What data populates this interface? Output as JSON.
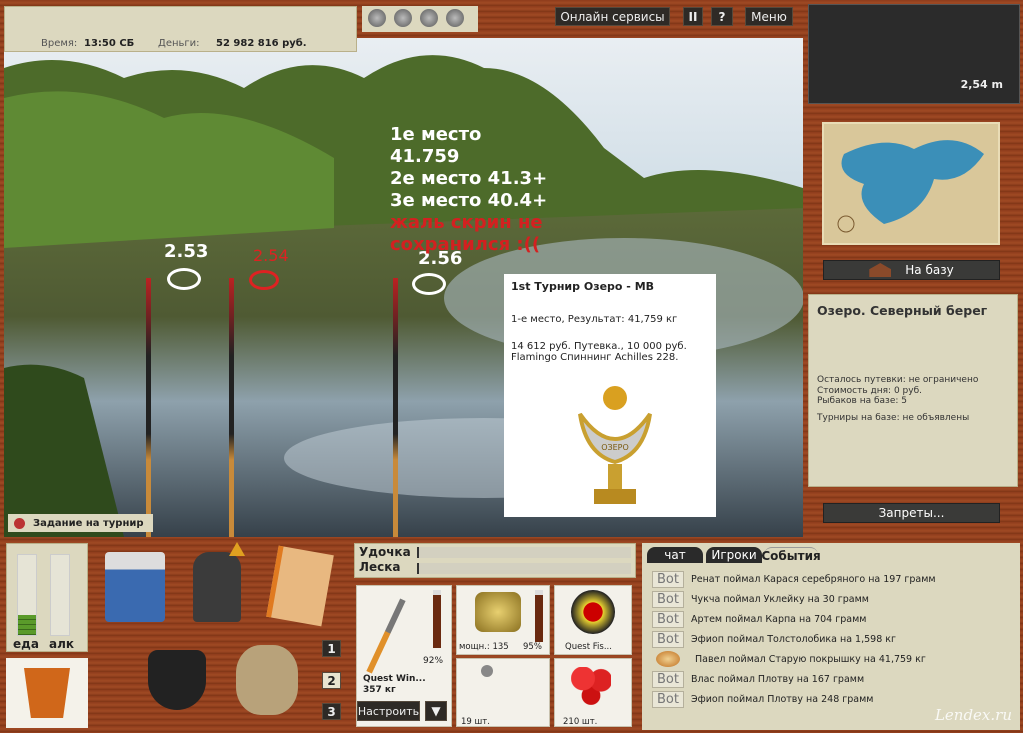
{
  "status": {
    "time_label": "Время:",
    "time": "13:50 СБ",
    "money_label": "Деньги:",
    "money": "52 982 816 руб."
  },
  "top_buttons": {
    "online": "Онлайн сервисы",
    "pause": "II",
    "help": "?",
    "menu": "Меню"
  },
  "depth": "2,54 m",
  "base_button": "На базу",
  "location": {
    "title": "Озеро. Северный берег",
    "permits": "Осталось путевки: не ограничено",
    "day_cost": "Стоимость дня: 0 руб.",
    "fishers": "Рыбаков на базе: 5",
    "tournaments": "Турниры на базе: не объявлены"
  },
  "bans_button": "Запреты...",
  "overlay": {
    "line1": "1е место 41.759",
    "line2": "2е место 41.3+",
    "line3": "3е место 40.4+",
    "line4": "жаль скрин не сохранился :((",
    "float1": "2.53",
    "float2": "2.54",
    "float3": "2.56"
  },
  "tournament": {
    "title": "1st Турнир Озеро - МВ",
    "result": "1-е место, Результат: 41,759 кг",
    "prize1": "14 612 руб. Путевка., 10 000 руб.",
    "prize2": "Flamingo Спиннинг Achilles 228.",
    "trophy_text": "ОЗЕРО"
  },
  "task_button": "Задание на турнир",
  "gauges": {
    "food": "еда",
    "alc": "алк",
    "food_level": 0.25,
    "alc_level": 0
  },
  "slots": [
    "1",
    "2",
    "3"
  ],
  "tension": {
    "rod": "Удочка",
    "line": "Леска"
  },
  "gear": {
    "rod_name": "Quest Win...",
    "rod_weight": "357 кг",
    "rod_pct": "92%",
    "reel_power": "мощн.: 135",
    "reel_pct": "95%",
    "line_name": "Quest Fis...",
    "hooks": "19 шт.",
    "bait": "210 шт.",
    "setup": "Настроить",
    "dropdown": "▼"
  },
  "chat": {
    "tabs": [
      "чат",
      "Игроки",
      "События"
    ],
    "active_tab": 2,
    "events": [
      {
        "badge": "Bot",
        "text": "Ренат поймал Карася серебряного на 197 грамм"
      },
      {
        "badge": "Bot",
        "text": "Чукча поймал Уклейку на 30 грамм"
      },
      {
        "badge": "Bot",
        "text": "Артем поймал Карпа на 704 грамм"
      },
      {
        "badge": "Bot",
        "text": "Эфиоп поймал Толстолобика на 1,598 кг"
      },
      {
        "badge": "",
        "text": "Павел поймал Старую покрышку на 41,759 кг"
      },
      {
        "badge": "Bot",
        "text": "Влас поймал Плотву на 167 грамм"
      },
      {
        "badge": "Bot",
        "text": "Эфиоп поймал Плотву на 248 грамм"
      }
    ]
  },
  "watermark": "Lendex.ru"
}
